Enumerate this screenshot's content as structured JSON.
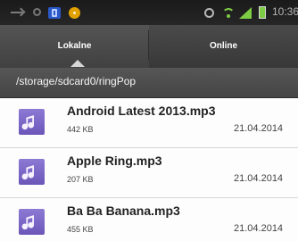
{
  "status_bar": {
    "time": "10:36",
    "icons": [
      "usb-icon",
      "sync-icon",
      "phone-icon",
      "notification-dot-icon",
      "alarm-icon",
      "wifi-icon",
      "signal-icon",
      "battery-icon"
    ],
    "accent_color": "#7ecb44"
  },
  "tabs": {
    "local": "Lokalne",
    "online": "Online"
  },
  "path": "/storage/sdcard0/ringPop",
  "files": [
    {
      "name": "Android Latest 2013.mp3",
      "size": "442 KB",
      "date": "21.04.2014"
    },
    {
      "name": "Apple Ring.mp3",
      "size": "207 KB",
      "date": "21.04.2014"
    },
    {
      "name": "Ba Ba Banana.mp3",
      "size": "455 KB",
      "date": "21.04.2014"
    }
  ],
  "colors": {
    "tab_bar": "#4a4a4a",
    "music_icon": "#7b67c8",
    "list_background": "#fdfdfd"
  }
}
